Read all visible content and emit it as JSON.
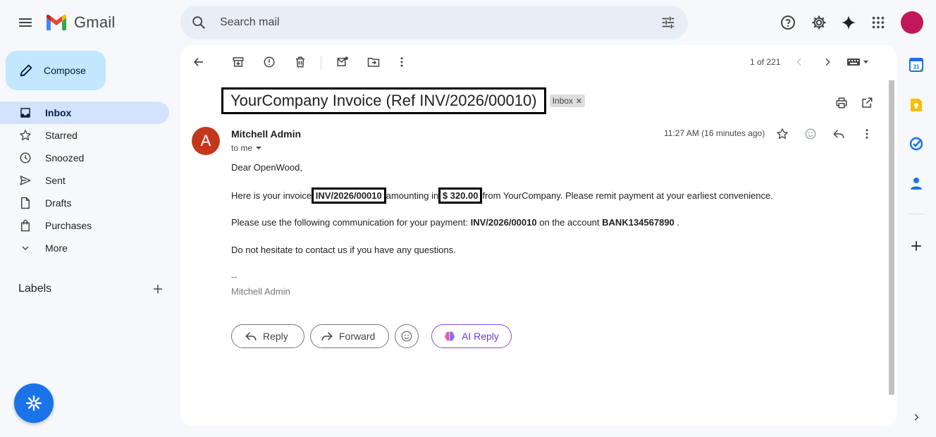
{
  "header": {
    "app_name": "Gmail",
    "search_placeholder": "Search mail",
    "icons": [
      "menu-icon",
      "search-icon",
      "tune-icon",
      "help-icon",
      "settings-icon",
      "gemini-icon",
      "apps-icon"
    ]
  },
  "sidebar": {
    "compose_label": "Compose",
    "items": [
      {
        "label": "Inbox",
        "icon": "inbox-icon",
        "active": true
      },
      {
        "label": "Starred",
        "icon": "star-icon"
      },
      {
        "label": "Snoozed",
        "icon": "clock-icon"
      },
      {
        "label": "Sent",
        "icon": "send-icon"
      },
      {
        "label": "Drafts",
        "icon": "draft-icon"
      },
      {
        "label": "Purchases",
        "icon": "bag-icon"
      },
      {
        "label": "More",
        "icon": "chevron-down-icon"
      }
    ],
    "labels_heading": "Labels"
  },
  "toolbar": {
    "pager_text": "1 of 221"
  },
  "email": {
    "subject": "YourCompany Invoice (Ref INV/2026/00010)",
    "label_chip": "Inbox",
    "sender_avatar_letter": "A",
    "sender_name": "Mitchell Admin",
    "recipient": "to me",
    "time": "11:27 AM (16 minutes ago)",
    "greeting": "Dear OpenWood,",
    "line1_a": "Here is your invoice",
    "invoice_ref": "INV/2026/00010",
    "line1_b": "amounting in",
    "amount": "$ 320.00",
    "line1_c": "from YourCompany. Please remit payment at your earliest convenience.",
    "line2_a": "Please use the following communication for your payment:",
    "line2_ref": "INV/2026/00010",
    "line2_b": "on the account",
    "line2_account": "BANK134567890",
    "line2_c": ".",
    "line3": "Do not hesitate to contact us if you have any questions.",
    "sig_dash": "--",
    "sig_name": "Mitchell Admin"
  },
  "actions": {
    "reply": "Reply",
    "forward": "Forward",
    "ai_reply": "AI Reply"
  },
  "colors": {
    "accent": "#1a73e8",
    "compose_bg": "#c2e7ff",
    "active_nav": "#d3e3fd",
    "avatar_sender": "#c5371d",
    "avatar_user": "#c2185b"
  }
}
